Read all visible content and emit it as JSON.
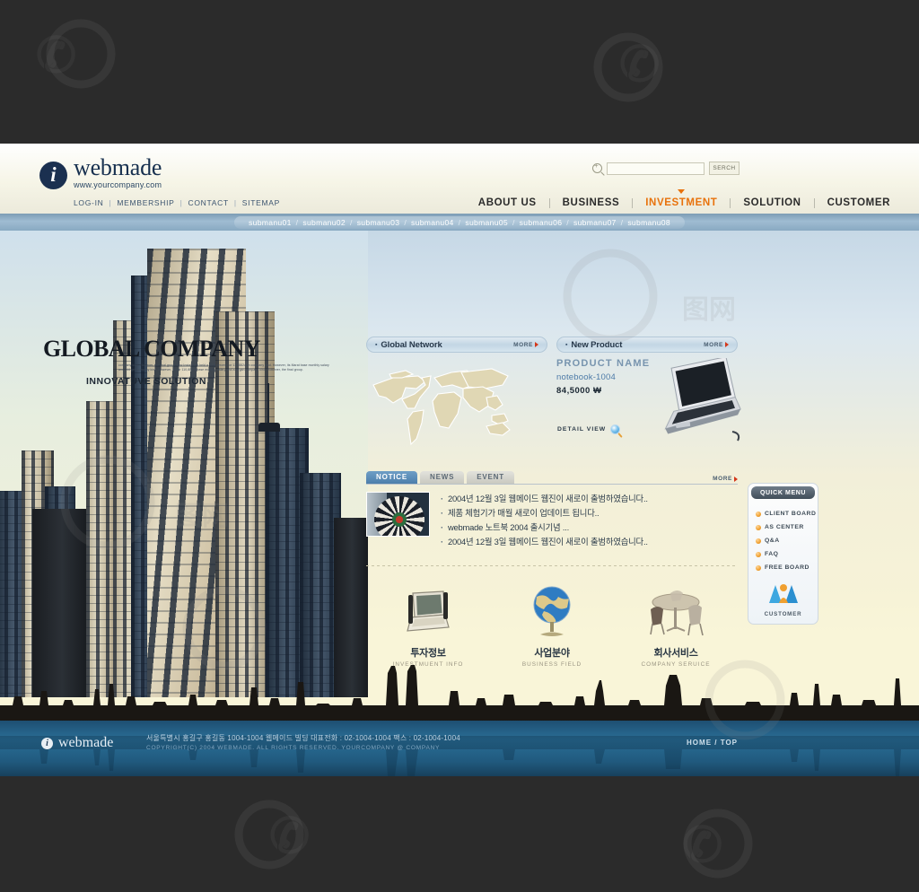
{
  "brand": {
    "name": "webmade",
    "url": "www.yourcompany.com",
    "mark": "i"
  },
  "toplinks": [
    {
      "label": "LOG-IN"
    },
    {
      "label": "MEMBERSHIP"
    },
    {
      "label": "CONTACT"
    },
    {
      "label": "SITEMAP"
    }
  ],
  "search": {
    "value": "",
    "placeholder": "",
    "button": "SERCH",
    "icon": "magnifier-icon"
  },
  "mainnav": [
    {
      "label": "ABOUT US",
      "active": false
    },
    {
      "label": "BUSINESS",
      "active": false
    },
    {
      "label": "INVESTMENT",
      "active": true
    },
    {
      "label": "SOLUTION",
      "active": false
    },
    {
      "label": "CUSTOMER",
      "active": false
    }
  ],
  "submenu": [
    "submanu01",
    "submanu02",
    "submanu03",
    "submanu04",
    "submanu05",
    "submanu06",
    "submanu07",
    "submanu08"
  ],
  "hero": {
    "title": "GLOBAL COMPANY",
    "blurb": "company kind. However, the final group.view Instalment held a 10.8 percent, or 110,882won company kind. However, its Marat  base monthly salary and 444 get  company kind. However, the or 110,884-5 base monthly salary and a largan   company kind. However, the final group.",
    "subtitle": "INNOVATUVE SOLUTION"
  },
  "panels": {
    "network": {
      "title": "Global Network",
      "more": "MORE"
    },
    "product": {
      "title": "New Product",
      "more": "MORE",
      "name": "PRODUCT  NAME",
      "model": "notebook-1004",
      "price": "84,5000 ₩",
      "detail": "DETAIL VIEW"
    }
  },
  "notice": {
    "tabs": [
      {
        "label": "NOTICE",
        "active": true
      },
      {
        "label": "NEWS",
        "active": false
      },
      {
        "label": "EVENT",
        "active": false
      }
    ],
    "more": "MORE",
    "items": [
      "2004년 12월 3일 웹메이드 웹진이 새로이 출범하였습니다..",
      "제품 체험기가 매월 새로이 업데이트 됩니다..",
      "webmade 노트북 2004  출시기념 ...",
      "2004년 12월 3일 웹메이드 웹진이 새로이 출범하였습니다.."
    ]
  },
  "shortcuts": [
    {
      "kr": "투자정보",
      "en": "INVESTMUENT INFO",
      "icon": "laptop-icon"
    },
    {
      "kr": "사업분야",
      "en": "BUSINESS FIELD",
      "icon": "globe-icon"
    },
    {
      "kr": "회사서비스",
      "en": "COMPANY SERUICE",
      "icon": "table-chairs-icon"
    }
  ],
  "quickmenu": {
    "title": "QUICK MENU",
    "items": [
      "CLIENT BOARD",
      "AS CENTER",
      "Q&A",
      "FAQ",
      "FREE BOARD"
    ],
    "footer": {
      "label": "CUSTOMER",
      "icon": "people-icon"
    }
  },
  "footer": {
    "brand": "webmade",
    "mark": "i",
    "address": "서울특별시 홍길구 홍길동 1004-1004 웹메이드 빌딩    대표전화 : 02-1004-1004  팩스 : 02-1004-1004",
    "copyright": "COPYRIGHT(C) 2004 WEBMADE. ALL RIGHTS RESERVED. YOURCOMPANY @ COMPANY",
    "top": "HOME / TOP"
  },
  "colors": {
    "accent": "#e8720c",
    "nav_bar": "#9fbcd2",
    "panel_title": "#c3d6e4",
    "tab_on": "#4d7fab",
    "water": "#2a6e96",
    "quick_bullet": "#f0a030"
  }
}
